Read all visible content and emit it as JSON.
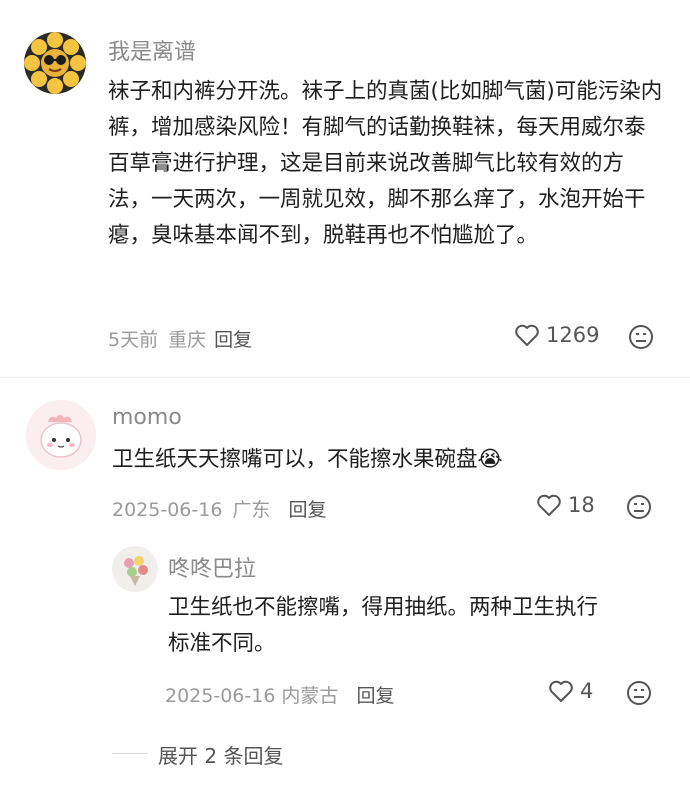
{
  "comments": [
    {
      "user": "我是离谱",
      "text": "袜子和内裤分开洗。袜子上的真菌(比如脚气菌)可能污染内裤，增加感染风险！有脚气的话勤换鞋袜，每天用威尔泰百草膏进行护理，这是目前来说改善脚气比较有效的方法，一天两次，一周就见效，脚不那么痒了，水泡开始干瘪，臭味基本闻不到，脱鞋再也不怕尴尬了。",
      "time": "5天前",
      "location": "重庆",
      "reply_label": "回复",
      "likes": "1269"
    },
    {
      "user": "momo",
      "text": "卫生纸天天擦嘴可以，不能擦水果碗盘",
      "emoji": "😭",
      "time": "2025-06-16",
      "location": "广东",
      "reply_label": "回复",
      "likes": "18"
    }
  ],
  "reply": {
    "user": "咚咚巴拉",
    "text": "卫生纸也不能擦嘴，得用抽纸。两种卫生执行标准不同。",
    "time": "2025-06-16",
    "location": "内蒙古",
    "reply_label": "回复",
    "likes": "4"
  },
  "expand_label": "展开 2 条回复",
  "icons": {
    "like": "heart-outline-icon",
    "dislike": "frown-face-icon"
  }
}
